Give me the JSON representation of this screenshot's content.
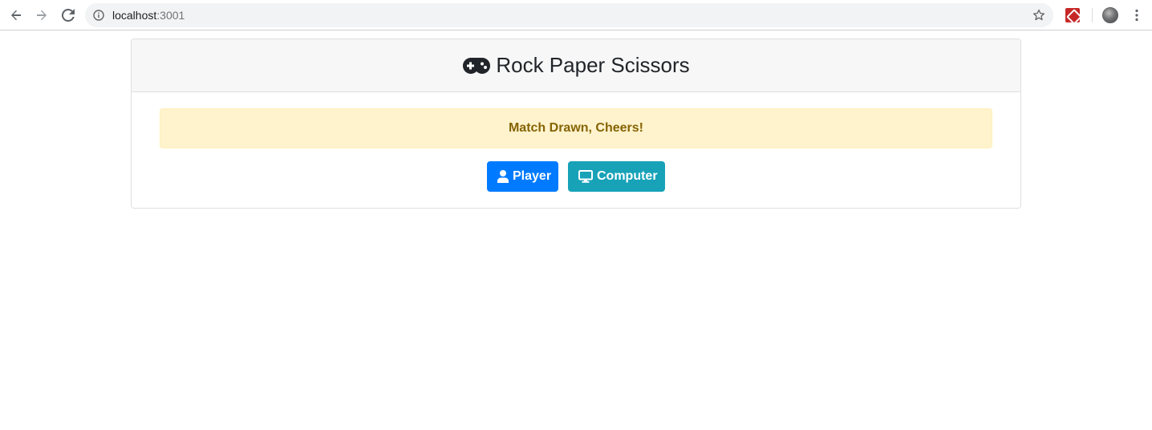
{
  "browser": {
    "url_host": "localhost",
    "url_port": ":3001"
  },
  "card": {
    "title": "Rock Paper Scissors",
    "title_icon": "gamepad-icon"
  },
  "alert": {
    "message": "Match Drawn, Cheers!",
    "colors": {
      "background": "#fff3cd",
      "text": "#856404"
    }
  },
  "buttons": {
    "player": {
      "label": "Player",
      "icon": "user-icon",
      "color": "#007bff"
    },
    "computer": {
      "label": "Computer",
      "icon": "desktop-icon",
      "color": "#17a2b8"
    }
  }
}
